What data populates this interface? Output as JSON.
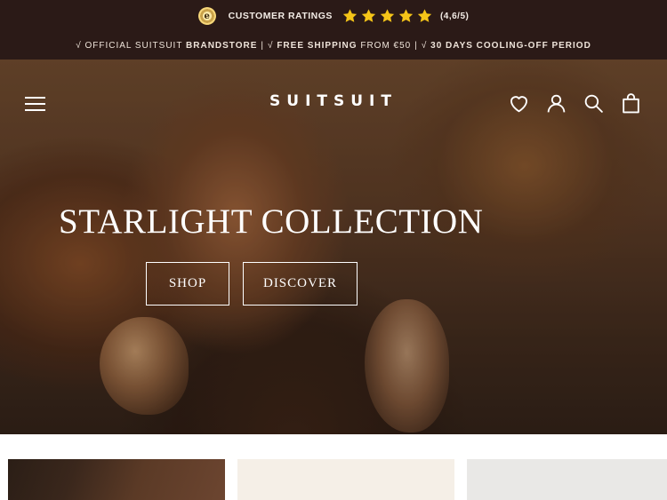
{
  "topbar": {
    "seal_glyph": "e",
    "ratings_label": "CUSTOMER RATINGS",
    "stars_count": 5,
    "star_color": "#f5c518",
    "score": "(4,6/5)",
    "usps": [
      {
        "prefix": "√ OFFICIAL SUITSUIT ",
        "strong": "BRANDSTORE"
      },
      {
        "prefix": "√ ",
        "strong": "FREE SHIPPING",
        "suffix": " FROM €50"
      },
      {
        "prefix": "√ ",
        "strong": "30 DAYS COOLING-OFF PERIOD"
      }
    ],
    "separator": "|"
  },
  "nav": {
    "logo": "SUITSUIT",
    "icons": [
      "menu-icon",
      "heart-icon",
      "account-icon",
      "search-icon",
      "bag-icon"
    ]
  },
  "hero": {
    "title": "STARLIGHT COLLECTION",
    "shop_label": "SHOP",
    "discover_label": "DISCOVER"
  },
  "colors": {
    "topbar_bg": "#2b1a17",
    "text_light": "#ffffff"
  }
}
